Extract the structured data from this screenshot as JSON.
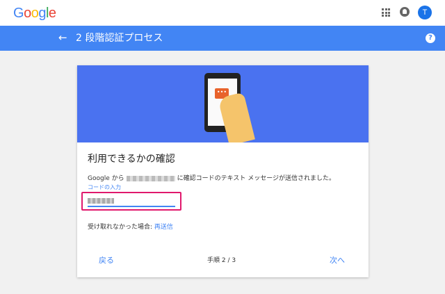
{
  "header": {
    "logo_letters": [
      {
        "ch": "G",
        "color": "#4285f4"
      },
      {
        "ch": "o",
        "color": "#ea4335"
      },
      {
        "ch": "o",
        "color": "#fbbc05"
      },
      {
        "ch": "g",
        "color": "#4285f4"
      },
      {
        "ch": "l",
        "color": "#34a853"
      },
      {
        "ch": "e",
        "color": "#ea4335"
      }
    ],
    "avatar_initial": "T",
    "icons": [
      "apps-grid-icon",
      "notifications-icon",
      "avatar"
    ]
  },
  "titlebar": {
    "back_icon": "←",
    "title": "2 段階認証プロセス",
    "help_icon": "?"
  },
  "card": {
    "bubble_icon": "•••",
    "heading": "利用できるかの確認",
    "message_prefix": "Google から",
    "message_suffix": "に確認コードのテキスト メッセージが送信されました。",
    "input_label": "コードの入力",
    "input_value": "",
    "resend_text": "受け取れなかった場合:",
    "resend_link": "再送信",
    "back_button": "戻る",
    "step_text": "手順 2 / 3",
    "next_button": "次へ"
  },
  "colors": {
    "accent": "#4285f4",
    "hero": "#4a72f0",
    "highlight": "#e0186c",
    "bubble": "#e8632b"
  }
}
